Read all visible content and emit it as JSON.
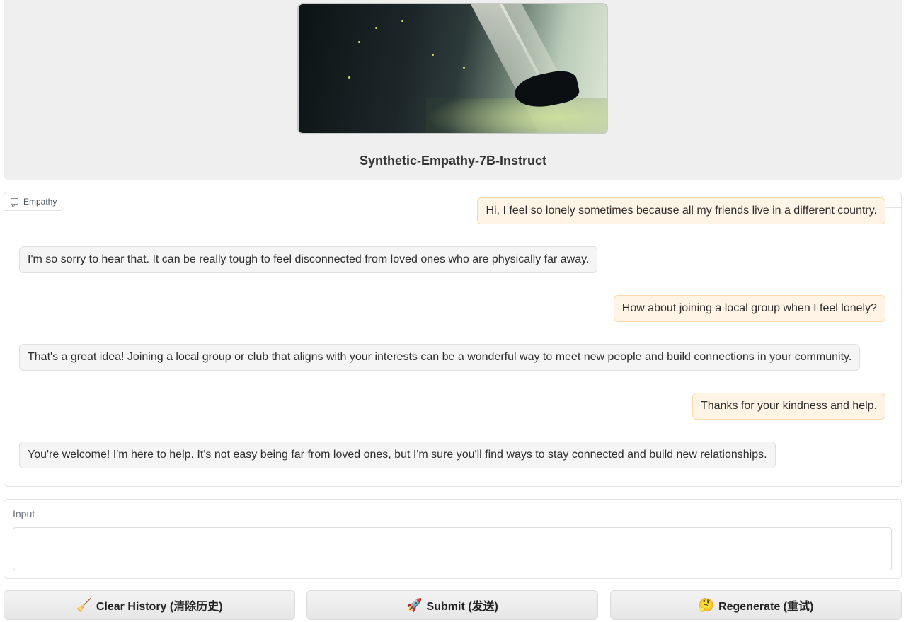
{
  "header": {
    "title": "Synthetic-Empathy-7B-Instruct"
  },
  "chatbot": {
    "label": "Empathy",
    "messages": [
      {
        "role": "user",
        "text": "Hi, I feel so lonely sometimes because all my friends live in a different country."
      },
      {
        "role": "bot",
        "text": "I'm so sorry to hear that. It can be really tough to feel disconnected from loved ones who are physically far away."
      },
      {
        "role": "user",
        "text": "How about joining a local group when I feel lonely?"
      },
      {
        "role": "bot",
        "text": "That's a great idea! Joining a local group or club that aligns with your interests can be a wonderful way to meet new people and build connections in your community."
      },
      {
        "role": "user",
        "text": "Thanks for your kindness and help."
      },
      {
        "role": "bot",
        "text": "You're welcome! I'm here to help. It's not easy being far from loved ones, but I'm sure you'll find ways to stay connected and build new relationships."
      }
    ]
  },
  "input": {
    "label": "Input",
    "value": "",
    "placeholder": ""
  },
  "buttons": {
    "clear": {
      "icon": "🧹",
      "label": "Clear History (清除历史)"
    },
    "submit": {
      "icon": "🚀",
      "label": "Submit (发送)"
    },
    "regenerate": {
      "icon": "🤔",
      "label": "Regenerate (重试)"
    }
  },
  "colors": {
    "user_bubble": "#fff4e5",
    "user_border": "#fcd9a6",
    "bot_bubble": "#f5f5f5",
    "header_bg": "#efefef"
  }
}
